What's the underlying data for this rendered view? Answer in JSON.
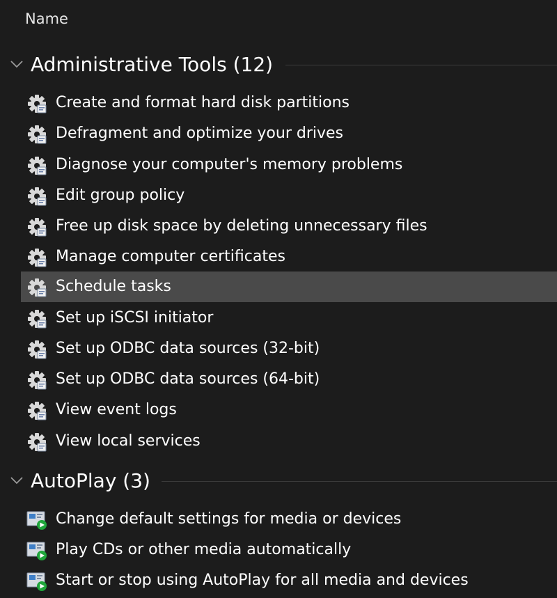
{
  "column_header": "Name",
  "groups": [
    {
      "title": "Administrative Tools (12)",
      "items": [
        {
          "label": "Create and format hard disk partitions",
          "icon": "admin-tools-gear-icon"
        },
        {
          "label": "Defragment and optimize your drives",
          "icon": "admin-tools-gear-icon"
        },
        {
          "label": "Diagnose your computer's memory problems",
          "icon": "admin-tools-gear-icon"
        },
        {
          "label": "Edit group policy",
          "icon": "admin-tools-gear-icon"
        },
        {
          "label": "Free up disk space by deleting unnecessary files",
          "icon": "admin-tools-gear-icon"
        },
        {
          "label": "Manage computer certificates",
          "icon": "admin-tools-gear-icon"
        },
        {
          "label": "Schedule tasks",
          "icon": "admin-tools-gear-icon",
          "selected": true
        },
        {
          "label": "Set up iSCSI initiator",
          "icon": "admin-tools-gear-icon"
        },
        {
          "label": "Set up ODBC data sources (32-bit)",
          "icon": "admin-tools-gear-icon"
        },
        {
          "label": "Set up ODBC data sources (64-bit)",
          "icon": "admin-tools-gear-icon"
        },
        {
          "label": "View event logs",
          "icon": "admin-tools-gear-icon"
        },
        {
          "label": "View local services",
          "icon": "admin-tools-gear-icon"
        }
      ]
    },
    {
      "title": "AutoPlay (3)",
      "items": [
        {
          "label": "Change default settings for media or devices",
          "icon": "autoplay-icon"
        },
        {
          "label": "Play CDs or other media automatically",
          "icon": "autoplay-icon"
        },
        {
          "label": "Start or stop using AutoPlay for all media and devices",
          "icon": "autoplay-icon"
        }
      ]
    }
  ],
  "colors": {
    "background": "#1c1c1c",
    "selected_row": "#4a4a4a",
    "text": "#ffffff",
    "autoplay_green": "#1fa53b"
  }
}
